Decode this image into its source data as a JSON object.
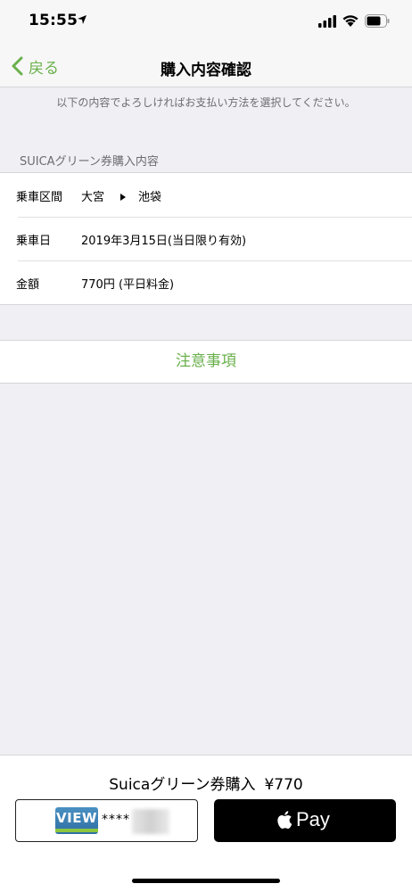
{
  "status_bar": {
    "time": "15:55"
  },
  "nav": {
    "back_label": "戻る",
    "title": "購入内容確認"
  },
  "notice": "以下の内容でよろしければお支払い方法を選択してください。",
  "section": {
    "header": "SUICAグリーン券購入内容",
    "rows": [
      {
        "label": "乗車区間",
        "from": "大宮",
        "to": "池袋"
      },
      {
        "label": "乗車日",
        "value": "2019年3月15日(当日限り有効)"
      },
      {
        "label": "金額",
        "value": "770円 (平日料金)"
      }
    ]
  },
  "caution_label": "注意事項",
  "bottom": {
    "summary_label": "Suicaグリーン券購入",
    "summary_price": "¥770",
    "card_logo_text": "VIEW",
    "card_mask": "****",
    "apple_pay_text": "Pay"
  },
  "colors": {
    "accent": "#6ab04c",
    "background": "#efeff4"
  },
  "icons": [
    "location-arrow-icon",
    "signal-icon",
    "wifi-icon",
    "battery-icon",
    "chevron-left-icon",
    "apple-logo-icon"
  ]
}
